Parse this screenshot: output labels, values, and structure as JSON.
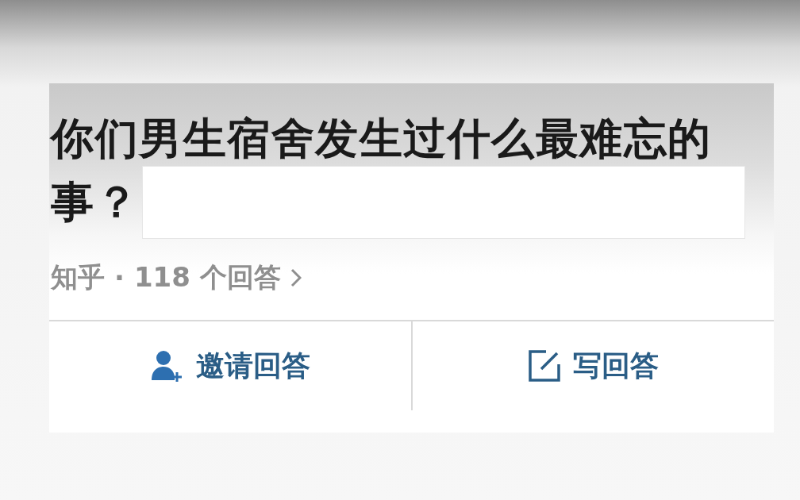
{
  "question": {
    "title_lines": [
      "你们男生宿舍发生过什么最难忘的",
      "事？"
    ],
    "source": "知乎",
    "separator": "·",
    "answer_count": "118 个回答"
  },
  "actions": [
    {
      "kind": "invite",
      "label": "邀请回答"
    },
    {
      "kind": "write",
      "label": "写回答"
    }
  ]
}
